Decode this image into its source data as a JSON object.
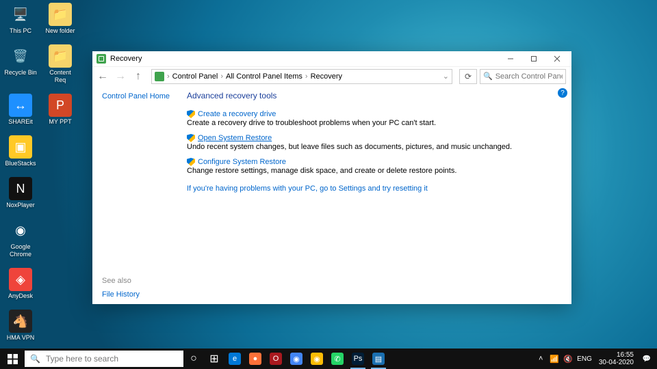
{
  "desktop": {
    "icons": [
      {
        "label": "This PC",
        "bg": "",
        "glyph": "🖥️"
      },
      {
        "label": "New folder",
        "bg": "#f6d46b",
        "glyph": "📁"
      },
      {
        "label": "Recycle Bin",
        "bg": "",
        "glyph": "🗑️"
      },
      {
        "label": "Content Req",
        "bg": "#f6d46b",
        "glyph": "📁"
      },
      {
        "label": "SHAREit",
        "bg": "#1e90ff",
        "glyph": "↔"
      },
      {
        "label": "MY PPT",
        "bg": "#d24726",
        "glyph": "P"
      },
      {
        "label": "BlueStacks",
        "bg": "#ffc926",
        "glyph": "▣"
      },
      {
        "label": "",
        "bg": "transparent",
        "glyph": ""
      },
      {
        "label": "NoxPlayer",
        "bg": "#111",
        "glyph": "N"
      },
      {
        "label": "",
        "bg": "transparent",
        "glyph": ""
      },
      {
        "label": "Google Chrome",
        "bg": "",
        "glyph": "◉"
      },
      {
        "label": "",
        "bg": "transparent",
        "glyph": ""
      },
      {
        "label": "AnyDesk",
        "bg": "#ef443b",
        "glyph": "◈"
      },
      {
        "label": "",
        "bg": "transparent",
        "glyph": ""
      },
      {
        "label": "HMA VPN",
        "bg": "#222",
        "glyph": "🐴"
      }
    ]
  },
  "window": {
    "title": "Recovery",
    "breadcrumb": [
      "Control Panel",
      "All Control Panel Items",
      "Recovery"
    ],
    "search_placeholder": "Search Control Panel",
    "sidebar": {
      "home": "Control Panel Home",
      "see_also": "See also",
      "file_history": "File History"
    },
    "heading": "Advanced recovery tools",
    "help": "?",
    "tools": [
      {
        "title": "Create a recovery drive",
        "desc": "Create a recovery drive to troubleshoot problems when your PC can't start.",
        "hl": false
      },
      {
        "title": "Open System Restore",
        "desc": "Undo recent system changes, but leave files such as documents, pictures, and music unchanged.",
        "hl": true
      },
      {
        "title": "Configure System Restore",
        "desc": "Change restore settings, manage disk space, and create or delete restore points.",
        "hl": false
      }
    ],
    "settings_link": "If you're having problems with your PC, go to Settings and try resetting it"
  },
  "taskbar": {
    "search_placeholder": "Type here to search",
    "apps": [
      {
        "name": "edge",
        "bg": "#0078d7",
        "glyph": "e"
      },
      {
        "name": "firefox",
        "bg": "#ff7139",
        "glyph": "●"
      },
      {
        "name": "opera",
        "bg": "#a8191f",
        "glyph": "O"
      },
      {
        "name": "chromium",
        "bg": "#4285f4",
        "glyph": "◉"
      },
      {
        "name": "chrome",
        "bg": "#fbbc05",
        "glyph": "◉"
      },
      {
        "name": "whatsapp",
        "bg": "#25d366",
        "glyph": "✆"
      },
      {
        "name": "photoshop",
        "bg": "#001e36",
        "glyph": "Ps",
        "active": true
      },
      {
        "name": "control-panel",
        "bg": "#1a6fb0",
        "glyph": "▤",
        "active": true
      }
    ],
    "lang": "ENG",
    "time": "16:55",
    "date": "30-04-2020"
  }
}
